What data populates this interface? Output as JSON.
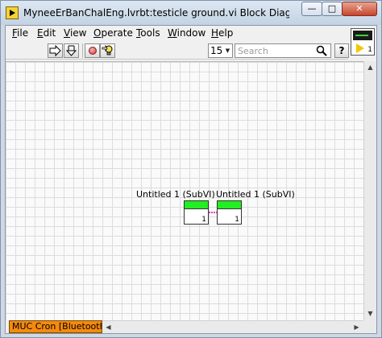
{
  "window": {
    "title": "MyneeErBanChalEng.lvrbt:testicle ground.vi Block Diagram on MU...",
    "minimize_label": "—",
    "maximize_label": "□",
    "close_label": "✕"
  },
  "menu": {
    "items": [
      {
        "underline": "F",
        "rest": "ile"
      },
      {
        "underline": "E",
        "rest": "dit"
      },
      {
        "underline": "V",
        "rest": "iew"
      },
      {
        "underline": "O",
        "rest": "perate"
      },
      {
        "underline": "T",
        "rest": "ools"
      },
      {
        "underline": "W",
        "rest": "indow"
      },
      {
        "underline": "H",
        "rest": "elp"
      }
    ]
  },
  "toolbar": {
    "font_size": "15",
    "search_placeholder": "Search",
    "help_label": "?",
    "vi_icon_number": "1"
  },
  "diagram": {
    "subvis": [
      {
        "label": "Untitled 1 (SubVI)",
        "number": "1"
      },
      {
        "label": "Untitled 1 (SubVI)",
        "number": "1"
      }
    ]
  },
  "status": {
    "context_label": "MUC Cron [Bluetooth]"
  },
  "colors": {
    "subvi_bar": "#22ee22",
    "wire": "#d646c8",
    "context_label_bg": "#f58a0d"
  }
}
